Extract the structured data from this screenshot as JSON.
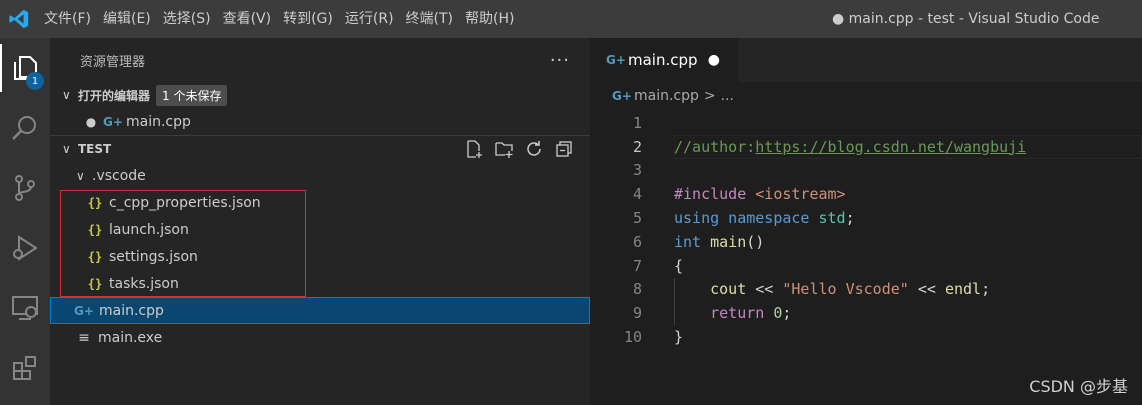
{
  "titlebar": {
    "menu": [
      "文件(F)",
      "编辑(E)",
      "选择(S)",
      "查看(V)",
      "转到(G)",
      "运行(R)",
      "终端(T)",
      "帮助(H)"
    ],
    "window_title": "● main.cpp - test - Visual Studio Code"
  },
  "activitybar": {
    "items": [
      "explorer-icon",
      "search-icon",
      "source-control-icon",
      "run-debug-icon",
      "remote-explorer-icon",
      "extensions-icon"
    ],
    "explorer_badge": "1"
  },
  "sidebar": {
    "title": "资源管理器",
    "more": "···",
    "open_editors": {
      "label": "打开的编辑器",
      "badge": "1 个未保存",
      "files": [
        {
          "name": "main.cpp",
          "icon_glyph": "G+",
          "modified": "●"
        }
      ]
    },
    "folder": {
      "label": "TEST",
      "subfolder": ".vscode",
      "json_files": [
        "c_cpp_properties.json",
        "launch.json",
        "settings.json",
        "tasks.json"
      ],
      "json_glyph": "{}",
      "main_cpp": "main.cpp",
      "main_exe": "main.exe"
    }
  },
  "editor": {
    "tab": {
      "label": "main.cpp",
      "modified_dot": "●"
    },
    "breadcrumb": {
      "file": "main.cpp",
      "sep": ">",
      "more": "..."
    },
    "line_numbers": [
      "1",
      "2",
      "3",
      "4",
      "5",
      "6",
      "7",
      "8",
      "9",
      "10"
    ],
    "code": {
      "comment_prefix": "//author:",
      "comment_link": "https://blog.csdn.net/wangbuji",
      "include_kw": "#include",
      "include_hdr": " <iostream>",
      "using_kw": "using",
      "namespace_kw": " namespace",
      "std": " std",
      "semi": ";",
      "int_kw": "int",
      "main_fn": " main",
      "parens": "()",
      "open_brace": "{",
      "cout": "    cout",
      "op1": " << ",
      "hello_str": "\"Hello Vscode\"",
      "op2": " << ",
      "endl": "endl",
      "end_semi": ";",
      "return_kw": "    return",
      "zero": " 0",
      "ret_semi": ";",
      "close_brace": "}"
    }
  },
  "watermark": "CSDN @步基",
  "colors": {
    "titlebar": "#3c3c3c",
    "activitybar": "#333333",
    "sidebar": "#252526",
    "editor": "#1e1e1e",
    "selection": "#094771",
    "highlight_box": "#d43030"
  }
}
